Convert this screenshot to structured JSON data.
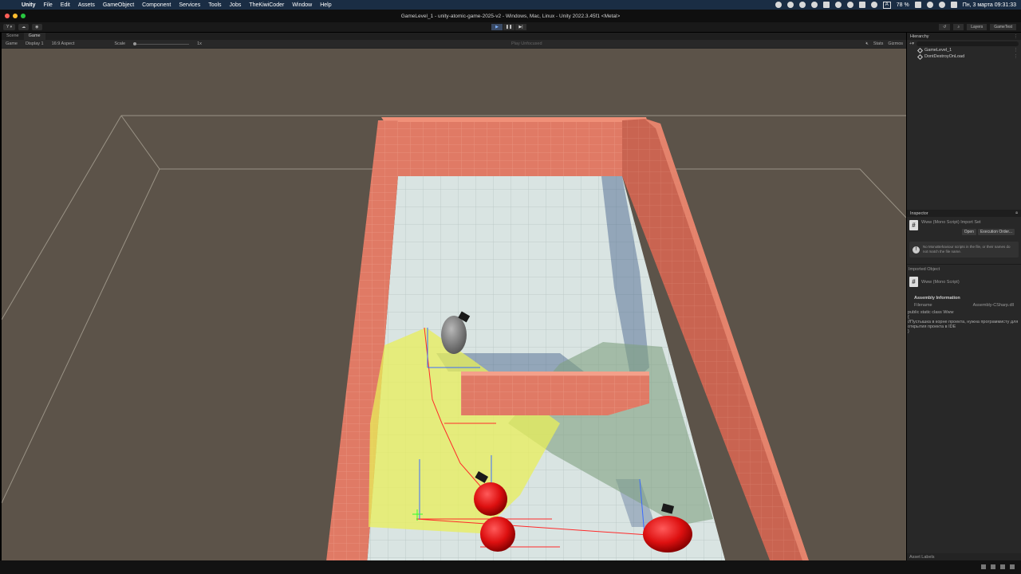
{
  "menubar": {
    "items": [
      "Unity",
      "File",
      "Edit",
      "Assets",
      "GameObject",
      "Component",
      "Services",
      "Tools",
      "Jobs",
      "TheKiwiCoder",
      "Window",
      "Help"
    ],
    "battery": "78 %",
    "datetime": "Пн, 3 марта  09:31:33",
    "input_source": "A"
  },
  "window": {
    "title": "GameLevel_1 - unity-atomic-game-2025-v2 - Windows, Mac, Linux - Unity 2022.3.45f1 <Metal>"
  },
  "toolbar": {
    "account_label": "Y ▾",
    "layers_label": "Layers",
    "layout_label": "GameTest"
  },
  "game_panel": {
    "tabs": [
      "Scene",
      "Game"
    ],
    "mode": "Game",
    "display": "Display 1",
    "aspect": "16:9 Aspect",
    "scale_label": "Scale",
    "scale_value": "1x",
    "play_focus": "Play Unfocused",
    "stats": "Stats",
    "gizmos": "Gizmos"
  },
  "hierarchy": {
    "title": "Hierarchy",
    "search_placeholder": "All",
    "rows": [
      "GameLevel_1",
      "DontDestroyOnLoad"
    ]
  },
  "inspector": {
    "title": "Inspector",
    "script_title": "Www (Mono Script) Import Set",
    "open_label": "Open",
    "execution_order_label": "Execution Order...",
    "help_text": "No MonoBehaviour scripts in the file, or their names do not match the file name.",
    "imported_object_label": "Imported Object",
    "imported_title": "Www (Mono Script)",
    "assembly_info_label": "Assembly Information",
    "filename_label": "Filename",
    "filename_value": "Assembly-CSharp.dll",
    "code_line1": "public static class Www",
    "code_line2": "{",
    "code_line3": "    //Пустышка в корне проекта, нужна программисту для открытия проекта в IDE",
    "code_line4": "}",
    "asset_labels": "Asset Labels"
  },
  "colors": {
    "wall": "#e07a65",
    "floor": "#d9e4e2",
    "ground": "#5c5349",
    "vision_yellow": "#e8ef5a",
    "vision_green": "#7fa080",
    "enemy": "#dd1010"
  }
}
